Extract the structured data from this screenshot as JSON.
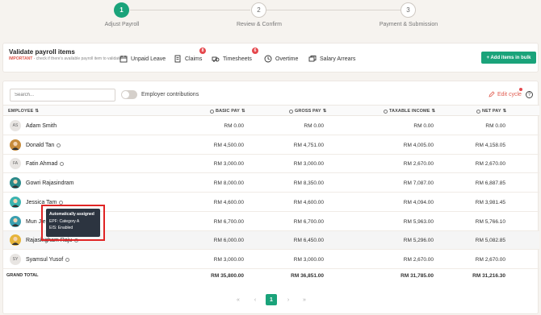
{
  "stepper": {
    "steps": [
      {
        "num": "1",
        "label": "Adjust Payroll"
      },
      {
        "num": "2",
        "label": "Review & Confirm"
      },
      {
        "num": "3",
        "label": "Payment & Submission"
      }
    ]
  },
  "validate": {
    "title": "Validate payroll items",
    "important": "IMPORTANT",
    "note": " - check if there's available payroll item to validate",
    "toolbar": [
      {
        "label": "Unpaid Leave",
        "icon": "calendar-icon"
      },
      {
        "label": "Claims",
        "icon": "receipt-icon",
        "badge": "8"
      },
      {
        "label": "Timesheets",
        "icon": "clock-truck-icon",
        "badge": "6"
      },
      {
        "label": "Overtime",
        "icon": "clock-icon"
      },
      {
        "label": "Salary Arrears",
        "icon": "stack-icon"
      }
    ],
    "add_button": "+ Add items in bulk"
  },
  "table_controls": {
    "search_placeholder": "Search...",
    "toggle_label": "Employer contributions",
    "edit_cycle": "Edit cycle",
    "help": "?"
  },
  "columns": {
    "employee": "EMPLOYEE",
    "basic_pay": "BASIC PAY",
    "gross_pay": "GROSS PAY",
    "taxable_income": "TAXABLE INCOME",
    "net_pay": "NET PAY",
    "sort_glyph": "⇅"
  },
  "rows": [
    {
      "initials": "AS",
      "name": "Adam Smith",
      "basic": "RM 0.00",
      "gross": "RM 0.00",
      "taxable": "RM 0.00",
      "net": "RM 0.00",
      "photo": false,
      "info": false
    },
    {
      "initials": "",
      "name": "Donald Tan",
      "basic": "RM 4,500.00",
      "gross": "RM 4,751.00",
      "taxable": "RM 4,005.00",
      "net": "RM 4,158.05",
      "photo": true,
      "photo_color": "#c78b3b",
      "info": true
    },
    {
      "initials": "FA",
      "name": "Fatin Ahmad",
      "basic": "RM 3,000.00",
      "gross": "RM 3,000.00",
      "taxable": "RM 2,670.00",
      "net": "RM 2,670.00",
      "photo": false,
      "info": true
    },
    {
      "initials": "",
      "name": "Gowri Rajasindram",
      "basic": "RM 8,000.00",
      "gross": "RM 8,350.00",
      "taxable": "RM 7,087.00",
      "net": "RM 6,887.85",
      "photo": true,
      "photo_color": "#2c8a8a",
      "info": false
    },
    {
      "initials": "",
      "name": "Jessica Tam",
      "basic": "RM 4,600.00",
      "gross": "RM 4,600.00",
      "taxable": "RM 4,094.00",
      "net": "RM 3,981.45",
      "photo": true,
      "photo_color": "#3bb3b0",
      "info": true
    },
    {
      "initials": "",
      "name": "Mun Jie",
      "basic": "RM 6,700.00",
      "gross": "RM 6,700.00",
      "taxable": "RM 5,963.00",
      "net": "RM 5,766.10",
      "photo": true,
      "photo_color": "#3a9fb0",
      "info": false
    },
    {
      "initials": "",
      "name": "Rajasingham Raju",
      "basic": "RM 6,000.00",
      "gross": "RM 6,450.00",
      "taxable": "RM 5,296.00",
      "net": "RM 5,082.85",
      "photo": true,
      "photo_color": "#e6b43a",
      "info": true
    },
    {
      "initials": "SY",
      "name": "Syamsul Yusof",
      "basic": "RM 3,000.00",
      "gross": "RM 3,000.00",
      "taxable": "RM 2,670.00",
      "net": "RM 2,670.00",
      "photo": false,
      "info": true
    }
  ],
  "grand_total": {
    "label": "GRAND TOTAL",
    "basic": "RM 35,800.00",
    "gross": "RM 36,851.00",
    "taxable": "RM 31,785.00",
    "net": "RM 31,216.30"
  },
  "pagination": {
    "first": "«",
    "prev": "‹",
    "current": "1",
    "next": "›",
    "last": "»"
  },
  "tooltip": {
    "heading": "Automatically assigned",
    "line1": "EPF: Category A",
    "line2": "EIS: Enabled"
  },
  "colors": {
    "accent": "#1aa37a",
    "badge": "#e5484d",
    "edit": "#e05a4e",
    "highlight_box": "#e02424"
  }
}
